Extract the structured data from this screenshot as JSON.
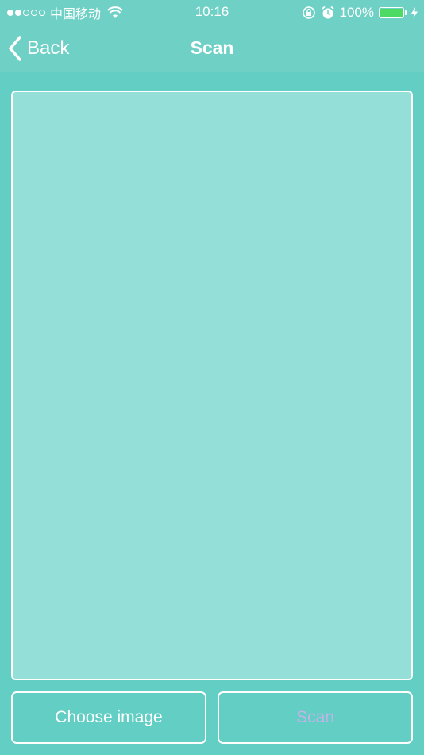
{
  "status_bar": {
    "carrier": "中国移动",
    "time": "10:16",
    "battery_percent": "100%",
    "battery_level": 1.0,
    "signal_strength": 2,
    "signal_max": 5,
    "icons": [
      "wifi-icon",
      "orientation-lock-icon",
      "alarm-icon",
      "battery-icon",
      "charging-icon"
    ]
  },
  "nav": {
    "back_label": "Back",
    "title": "Scan"
  },
  "actions": {
    "choose_image_label": "Choose image",
    "scan_label": "Scan"
  },
  "colors": {
    "background": "#62cec4",
    "scan_area": "#94dfd8",
    "scan_label_disabled": "#c3b4e8",
    "battery_fill": "#4cd964"
  }
}
